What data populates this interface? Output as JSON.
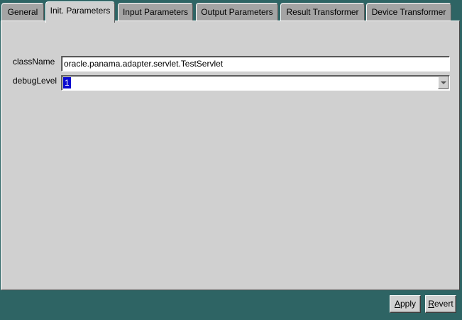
{
  "tabs": [
    {
      "label": "General"
    },
    {
      "label": "Init. Parameters",
      "active": true
    },
    {
      "label": "Input Parameters"
    },
    {
      "label": "Output Parameters"
    },
    {
      "label": "Result Transformer"
    },
    {
      "label": "Device Transformer"
    }
  ],
  "form": {
    "class_name_label": "className",
    "class_name_value": "oracle.panama.adapter.servlet.TestServlet",
    "debug_level_label": "debugLevel",
    "debug_level_value": "1"
  },
  "buttons": {
    "apply_mnemonic": "A",
    "apply_rest": "pply",
    "revert_mnemonic": "R",
    "revert_rest": "evert"
  },
  "colors": {
    "background": "#2e6464",
    "panel": "#d0d0d0",
    "tab_inactive": "#a4a4a4",
    "selection": "#0a0ad0"
  }
}
